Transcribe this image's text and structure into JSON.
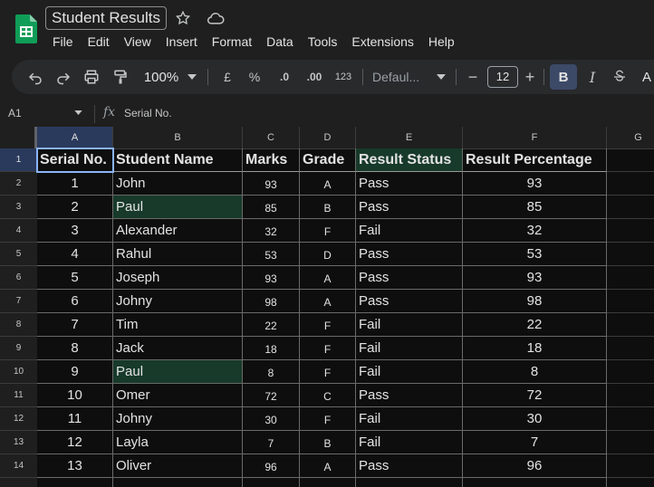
{
  "app": {
    "title": "Student Results",
    "menus": [
      "File",
      "Edit",
      "View",
      "Insert",
      "Format",
      "Data",
      "Tools",
      "Extensions",
      "Help"
    ]
  },
  "toolbar": {
    "zoom": "100%",
    "currency": "£",
    "percent": "%",
    "dec_decrease": ".0",
    "dec_increase": ".00",
    "number_format": "123",
    "font": "Defaul...",
    "font_size": "12",
    "bold": "B",
    "italic": "I",
    "text_color": "A"
  },
  "formula_bar": {
    "cell_ref": "A1",
    "fx": "fx",
    "value": "Serial No."
  },
  "sheet": {
    "columns": [
      "A",
      "B",
      "C",
      "D",
      "E",
      "F",
      "G"
    ],
    "row_numbers": [
      "1",
      "2",
      "3",
      "4",
      "5",
      "6",
      "7",
      "8",
      "9",
      "10",
      "11",
      "12",
      "13",
      "14"
    ],
    "header": [
      "Serial No.",
      "Student  Name",
      "Marks",
      "Grade",
      "Result Status",
      "Result Percentage"
    ],
    "rows": [
      [
        "1",
        "John",
        "93",
        "A",
        "Pass",
        "93"
      ],
      [
        "2",
        "Paul",
        "85",
        "B",
        "Pass",
        "85"
      ],
      [
        "3",
        "Alexander",
        "32",
        "F",
        "Fail",
        "32"
      ],
      [
        "4",
        "Rahul",
        "53",
        "D",
        "Pass",
        "53"
      ],
      [
        "5",
        "Joseph",
        "93",
        "A",
        "Pass",
        "93"
      ],
      [
        "6",
        "Johny",
        "98",
        "A",
        "Pass",
        "98"
      ],
      [
        "7",
        "Tim",
        "22",
        "F",
        "Fail",
        "22"
      ],
      [
        "8",
        "Jack",
        "18",
        "F",
        "Fail",
        "18"
      ],
      [
        "9",
        "Paul",
        "8",
        "F",
        "Fail",
        "8"
      ],
      [
        "10",
        "Omer",
        "72",
        "C",
        "Pass",
        "72"
      ],
      [
        "11",
        "Johny",
        "30",
        "F",
        "Fail",
        "30"
      ],
      [
        "12",
        "Layla",
        "7",
        "B",
        "Fail",
        "7"
      ],
      [
        "13",
        "Oliver",
        "96",
        "A",
        "Pass",
        "96"
      ]
    ],
    "highlight_color": "#173a2a",
    "selected_color": "#8ab4f8"
  }
}
